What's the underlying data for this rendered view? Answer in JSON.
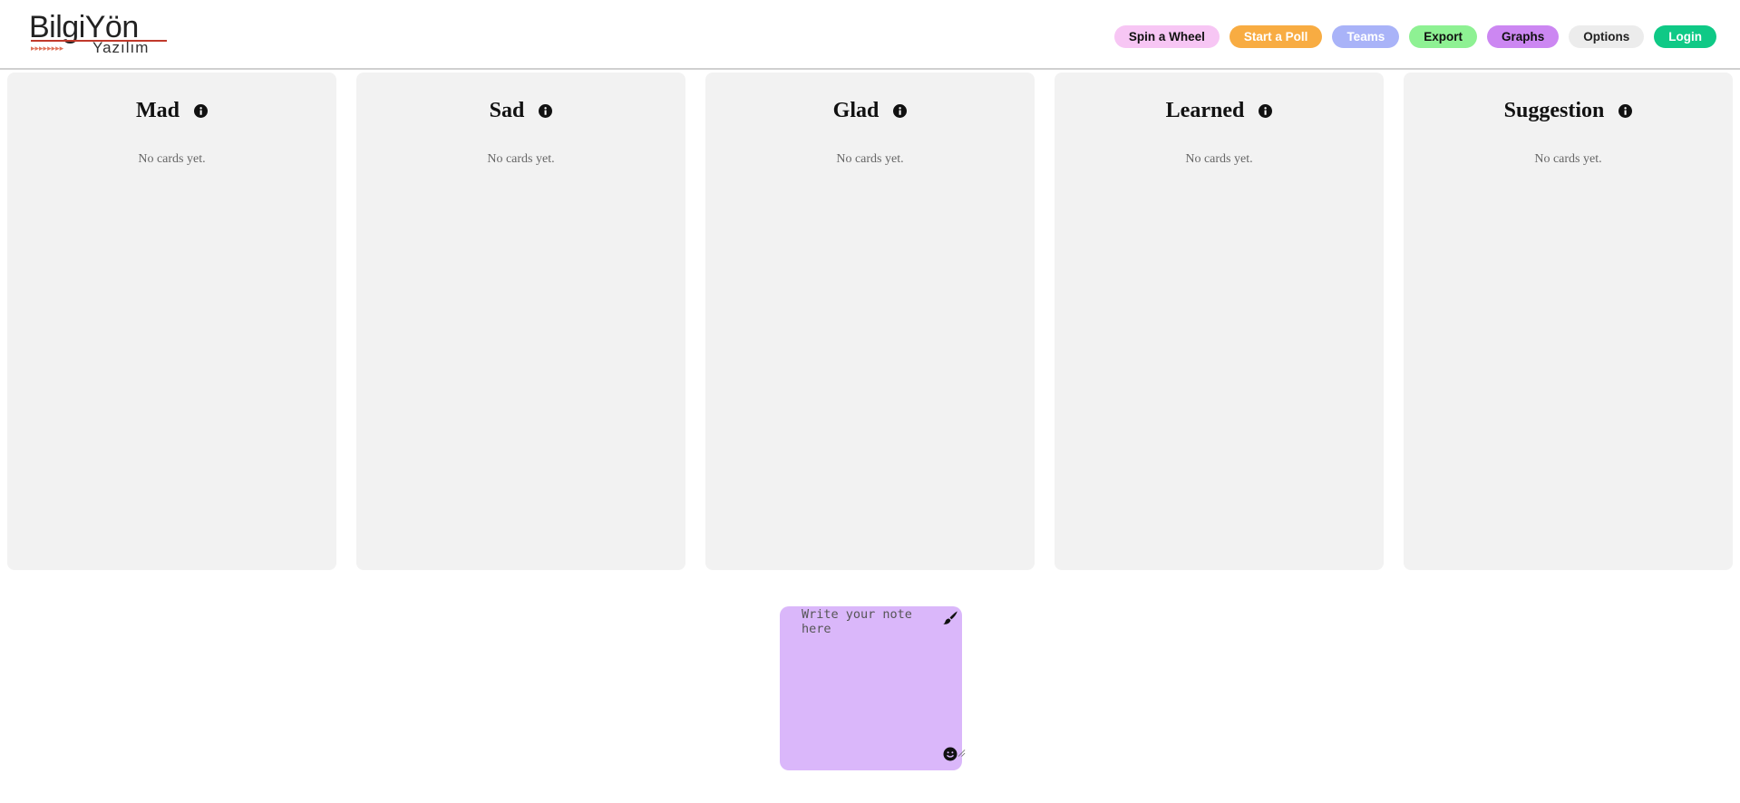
{
  "logo": {
    "word": "BilgiYön",
    "sub": "Yazılım",
    "arrows": "▸▸▸▸▸▸▸▸"
  },
  "nav": {
    "items": [
      {
        "label": "Spin a Wheel",
        "bg": "#f7c6f4",
        "color": "#111111"
      },
      {
        "label": "Start a Poll",
        "bg": "#f8ac42",
        "color": "#ffffff"
      },
      {
        "label": "Teams",
        "bg": "#a9b3f8",
        "color": "#ffffff"
      },
      {
        "label": "Export",
        "bg": "#8ef193",
        "color": "#111111"
      },
      {
        "label": "Graphs",
        "bg": "#cc87f2",
        "color": "#111111"
      },
      {
        "label": "Options",
        "bg": "#ececec",
        "color": "#222222"
      },
      {
        "label": "Login",
        "bg": "#0fc986",
        "color": "#ffffff"
      }
    ]
  },
  "columns": [
    {
      "title": "Mad",
      "empty": "No cards yet."
    },
    {
      "title": "Sad",
      "empty": "No cards yet."
    },
    {
      "title": "Glad",
      "empty": "No cards yet."
    },
    {
      "title": "Learned",
      "empty": "No cards yet."
    },
    {
      "title": "Suggestion",
      "empty": "No cards yet."
    }
  ],
  "note": {
    "placeholder": "Write your note here",
    "color": "#dab7fa",
    "icons": [
      "brush-icon",
      "emoji-icon"
    ]
  },
  "colors": {
    "column_bg": "#f2f2f2",
    "header_border": "#d0d0d0"
  }
}
